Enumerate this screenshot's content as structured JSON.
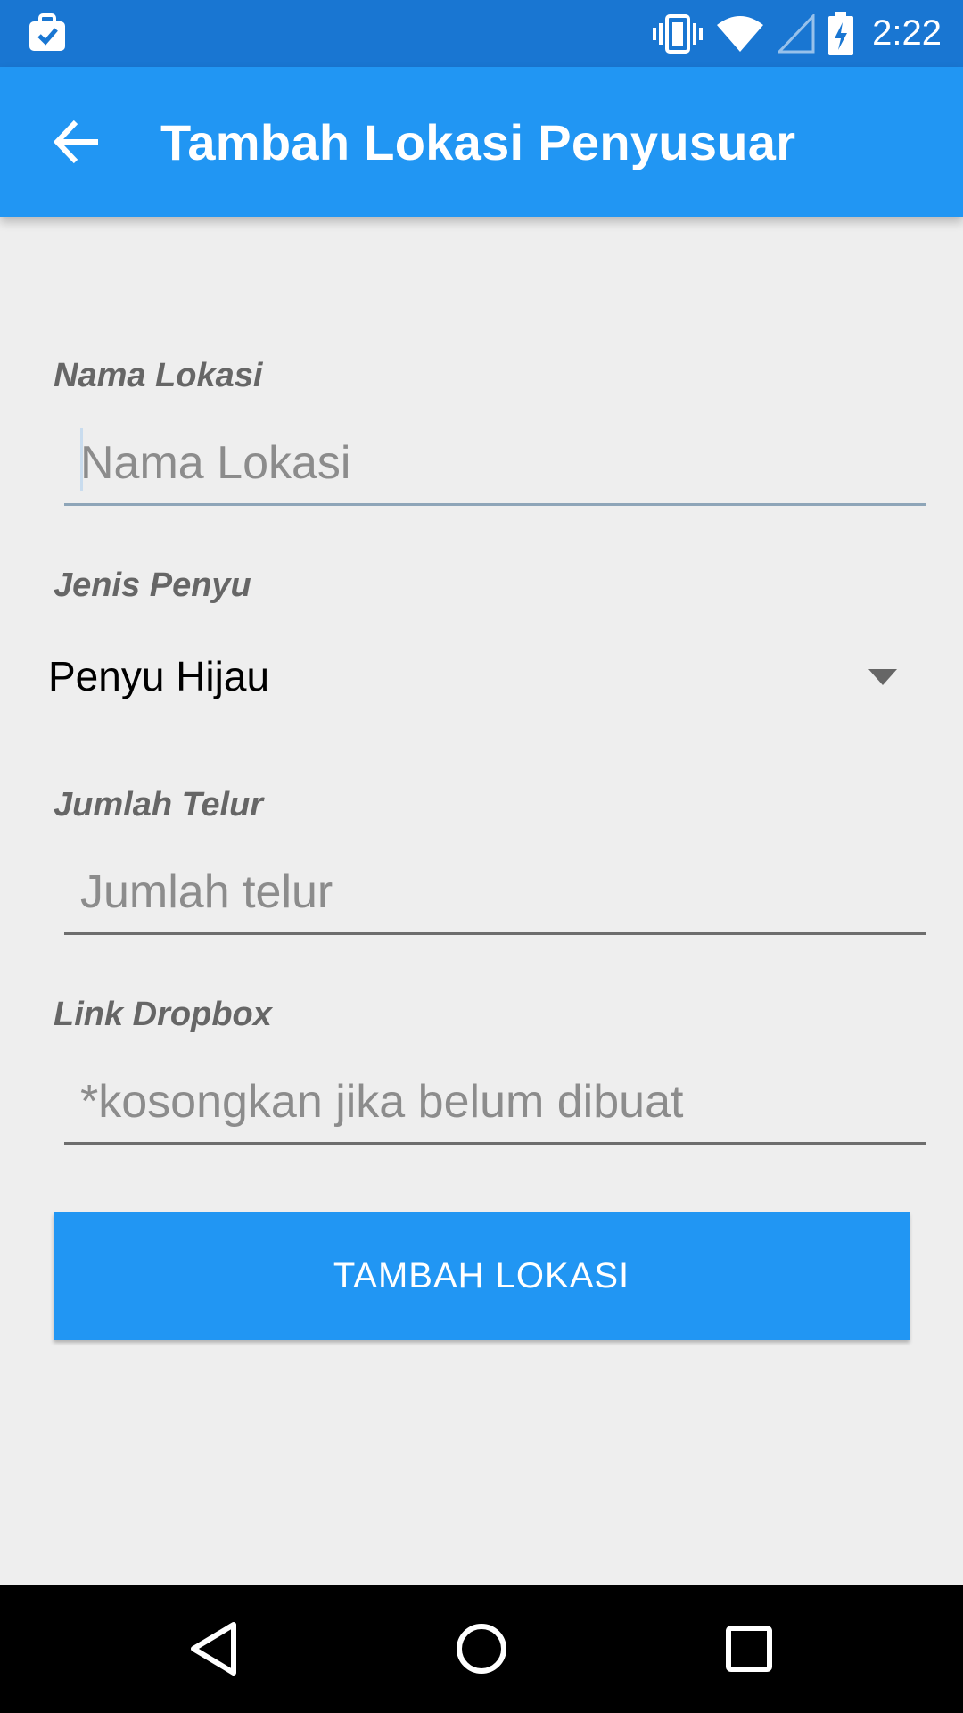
{
  "status_bar": {
    "time": "2:22",
    "icons": [
      "briefcase-check-icon",
      "vibrate-icon",
      "wifi-icon",
      "cell-signal-icon",
      "battery-charging-icon"
    ]
  },
  "app_bar": {
    "title": "Tambah Lokasi Penyusuar",
    "back_icon": "arrow-left-icon"
  },
  "form": {
    "nama_lokasi": {
      "label": "Nama Lokasi",
      "placeholder": "Nama Lokasi",
      "value": ""
    },
    "jenis_penyu": {
      "label": "Jenis Penyu",
      "selected": "Penyu Hijau",
      "icon": "dropdown-triangle-icon"
    },
    "jumlah_telur": {
      "label": "Jumlah Telur",
      "placeholder": "Jumlah telur",
      "value": ""
    },
    "link_dropbox": {
      "label": "Link Dropbox",
      "placeholder": "*kosongkan jika belum dibuat",
      "value": ""
    },
    "submit_label": "TAMBAH LOKASI"
  },
  "nav_bar": {
    "buttons": [
      "back-triangle-icon",
      "home-circle-icon",
      "recents-square-icon"
    ]
  },
  "colors": {
    "status_bar": "#1976d2",
    "app_bar": "#2196f3",
    "button": "#2196f3",
    "background": "#eeeeee"
  }
}
